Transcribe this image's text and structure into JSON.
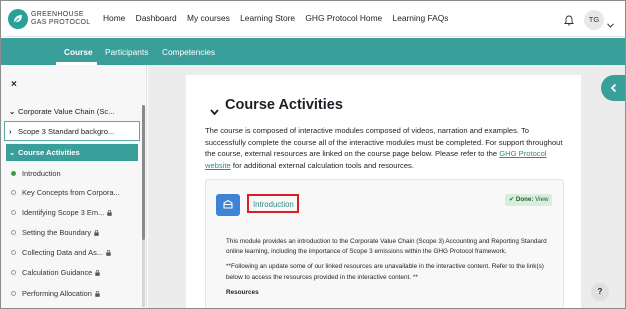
{
  "brand": {
    "line1": "GREENHOUSE",
    "line2": "GAS PROTOCOL"
  },
  "topnav": {
    "links": [
      "Home",
      "Dashboard",
      "My courses",
      "Learning Store",
      "GHG Protocol Home",
      "Learning FAQs"
    ],
    "avatar_initials": "TG"
  },
  "subnav": {
    "tabs": [
      "Course",
      "Participants",
      "Competencies"
    ]
  },
  "drawer": {
    "close": "×",
    "sections": [
      {
        "label": "Corporate Value Chain (Sc..."
      },
      {
        "label": "Scope 3 Standard backgro..."
      },
      {
        "label": "Course Activities"
      }
    ],
    "activities": [
      {
        "label": "Introduction",
        "done": true,
        "locked": false
      },
      {
        "label": "Key Concepts from Corpora...",
        "done": false,
        "locked": false
      },
      {
        "label": "Identifying Scope 3 Em...",
        "done": false,
        "locked": true
      },
      {
        "label": "Setting the Boundary",
        "done": false,
        "locked": true
      },
      {
        "label": "Collecting Data and As...",
        "done": false,
        "locked": true
      },
      {
        "label": "Calculation Guidance",
        "done": false,
        "locked": true
      },
      {
        "label": "Performing Allocation",
        "done": false,
        "locked": true
      }
    ]
  },
  "main": {
    "title": "Course Activities",
    "intro_part1": "The course is composed of interactive modules composed of videos, narration and examples. To successfully complete the course all of the interactive modules must be completed. For support throughout the course, external resources are linked on the course page below. Please refer to the ",
    "intro_link": "GHG Protocol website",
    "intro_part2": " for additional external calculation tools and resources.",
    "activity": {
      "link": "Introduction",
      "done_label": "Done:",
      "done_value": "View",
      "desc1": "This module provides an introduction to the Corporate Value Chain (Scope 3) Accounting and Reporting Standard online learning, including the importance of Scope 3 emissions within the GHG Protocol framework.",
      "desc2": "**Following an update some of our linked resources are unavailable in the interactive content. Refer to the link(s) below to access the resources provided in the interactive content. **",
      "resources": "Resources"
    }
  },
  "help": "?",
  "colors": {
    "teal": "#3a9e9a",
    "link": "#2e8b86",
    "highlight": "#d81f26",
    "icon_blue": "#3f82d6"
  }
}
